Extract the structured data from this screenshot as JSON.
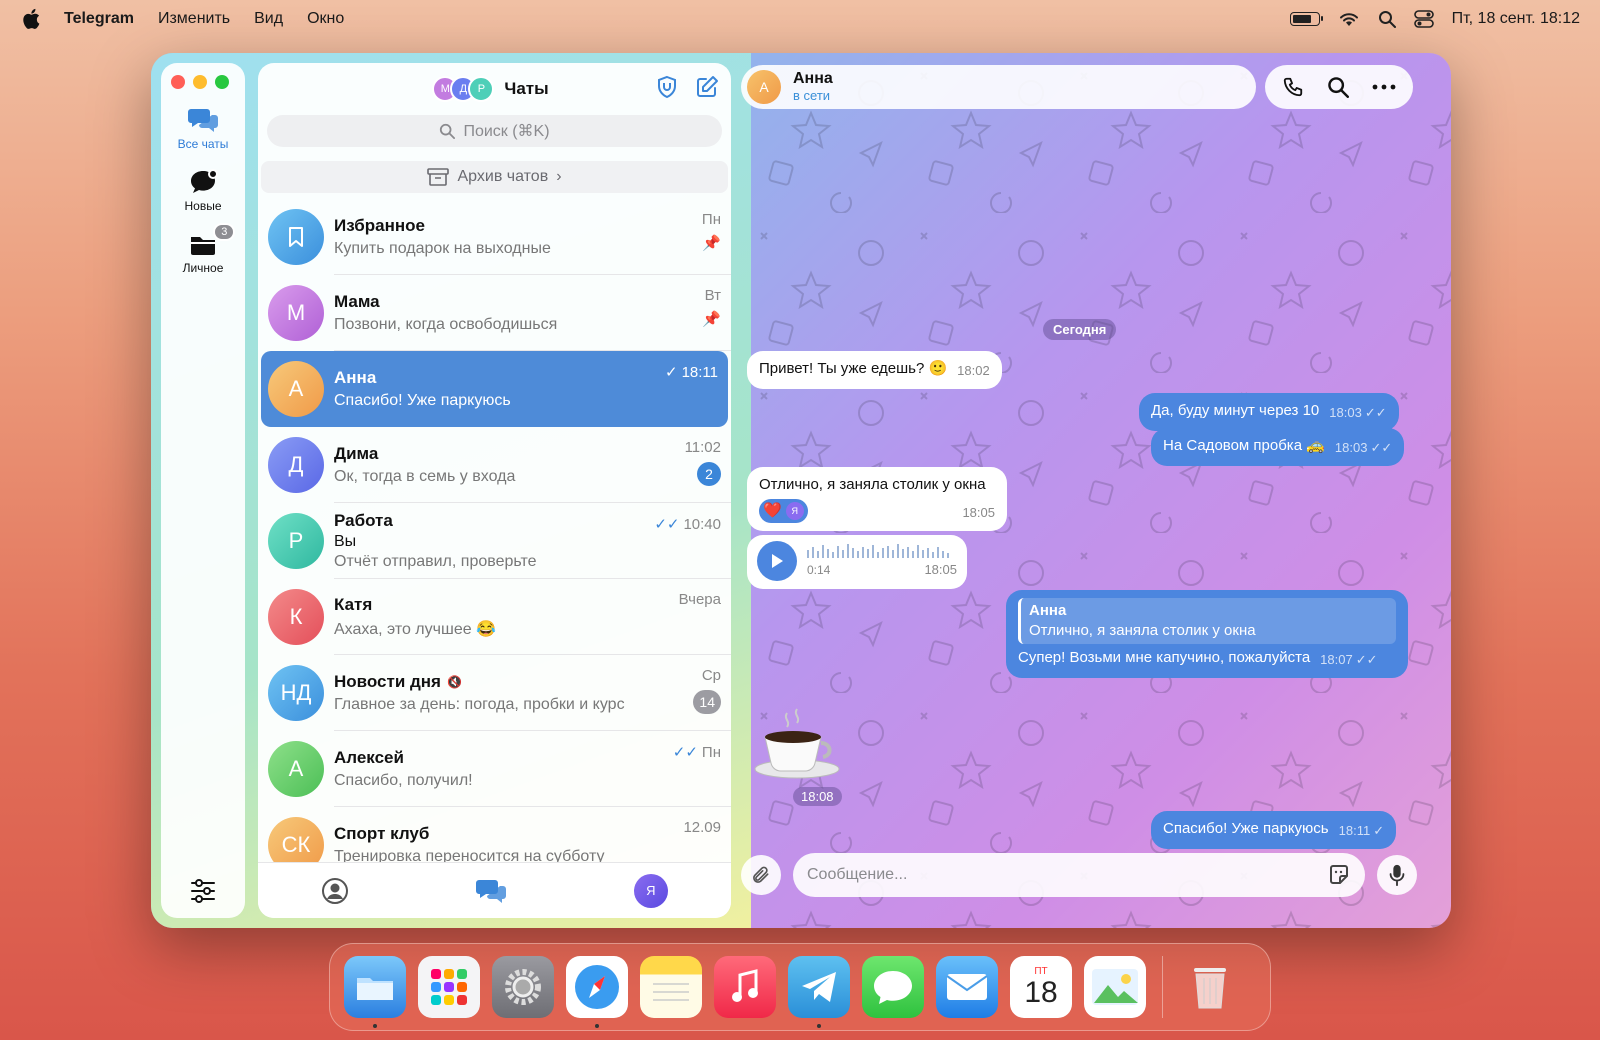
{
  "menubar": {
    "app": "Telegram",
    "items": [
      "Изменить",
      "Вид",
      "Окно"
    ],
    "datetime": "Пт, 18 сент. 18:12",
    "battery_level": 0.75
  },
  "rail": {
    "folders": [
      {
        "label": "Все чаты"
      },
      {
        "label": "Новые"
      },
      {
        "label": "Личное",
        "badge": "3"
      }
    ]
  },
  "list": {
    "title": "Чаты",
    "stack": [
      "М",
      "Д",
      "Р"
    ],
    "search_placeholder": "Поиск (⌘K)",
    "archive": "Архив чатов",
    "chats": [
      {
        "name": "Избранное",
        "msg": "Купить подарок на выходные",
        "time": "Пн",
        "pinned": true,
        "color": "#4aa6e8"
      },
      {
        "name": "Мама",
        "initial": "М",
        "msg": "Позвони, когда освободишься",
        "time": "Вт",
        "pinned": true,
        "color": "#c27ce0"
      },
      {
        "name": "Анна",
        "initial": "А",
        "msg": "Спасибо! Уже паркуюсь",
        "time": "18:11",
        "read": true,
        "selected": true,
        "color": "#f3b05a"
      },
      {
        "name": "Дима",
        "initial": "Д",
        "msg": "Ок, тогда в семь у входа",
        "time": "11:02",
        "badge": "2",
        "color": "#6a7ef0"
      },
      {
        "name": "Работа",
        "initial": "Р",
        "sender": "Вы",
        "msg": "Отчёт отправил, проверьте",
        "time": "10:40",
        "read": true,
        "color": "#4ecfb8"
      },
      {
        "name": "Катя",
        "initial": "К",
        "msg": "Ахаха, это лучшее 😂",
        "time": "Вчера",
        "color": "#ee6a6a"
      },
      {
        "name": "Новости дня",
        "initial": "НД",
        "msg": "Главное за день: погода, пробки и курс",
        "time": "Ср",
        "badge": "14",
        "muted": true,
        "color": "#4aa6e8"
      },
      {
        "name": "Алексей",
        "initial": "А",
        "msg": "Спасибо, получил!",
        "time": "Пн",
        "read": true,
        "color": "#6ccf6a"
      },
      {
        "name": "Спорт клуб",
        "initial": "СК",
        "msg": "Тренировка переносится на субботу",
        "time": "12.09",
        "color": "#f3b05a"
      }
    ],
    "me": "Я"
  },
  "chat": {
    "name": "Анна",
    "initial": "А",
    "status": "в сети",
    "date": "Сегодня",
    "m1": {
      "text": "Привет! Ты уже едешь? 🙂",
      "time": "18:02"
    },
    "m2": {
      "text": "Да, буду минут через 10",
      "time": "18:03"
    },
    "m3": {
      "text": "На Садовом пробка 🚕",
      "time": "18:03"
    },
    "m4": {
      "text": "Отлично, я заняла столик у окна",
      "time": "18:05",
      "reaction": "❤️",
      "reactor": "Я"
    },
    "m5": {
      "duration": "0:14",
      "time": "18:05"
    },
    "m6": {
      "reply_name": "Анна",
      "reply_text": "Отлично, я заняла столик у окна",
      "text": "Супер! Возьми мне капучино, пожалуйста",
      "time": "18:07"
    },
    "m7": {
      "time": "18:08"
    },
    "m8": {
      "text": "Спасибо! Уже паркуюсь",
      "time": "18:11"
    },
    "placeholder": "Сообщение..."
  },
  "dock": {
    "calendar_day": "18",
    "calendar_month": "ПТ"
  }
}
